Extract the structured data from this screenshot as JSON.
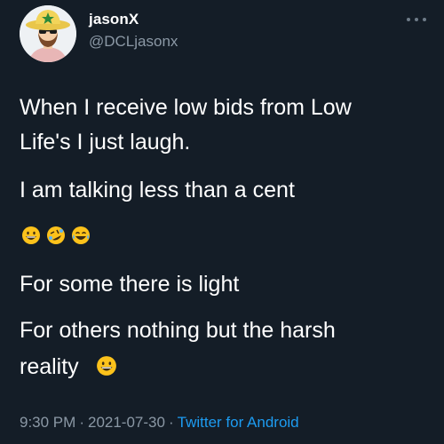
{
  "tweet": {
    "author": {
      "display_name": "jasonX",
      "handle": "@DCLjasonx",
      "avatar": "cartoon-cowboy-avatar-icon"
    },
    "more_menu_icon": "more-horizontal-icon",
    "body": {
      "line1": "When I receive low bids from Low",
      "line2": "Life's I just laugh.",
      "line3": "I am talking less than a cent",
      "emojis": [
        "grinning-face-icon",
        "rolling-on-floor-laughing-icon",
        "tears-of-joy-icon"
      ],
      "line4": "For some there is light",
      "line5": "For others nothing but the harsh",
      "line6": "reality",
      "line6_emoji": "grinning-face-icon"
    },
    "meta": {
      "time": "9:30 PM",
      "separator": "·",
      "date": "2021-07-30",
      "source": "Twitter for Android"
    }
  },
  "colors": {
    "background": "#15202b",
    "text": "#ffffff",
    "secondary_text": "#8b98a5",
    "link": "#1d9bf0"
  }
}
